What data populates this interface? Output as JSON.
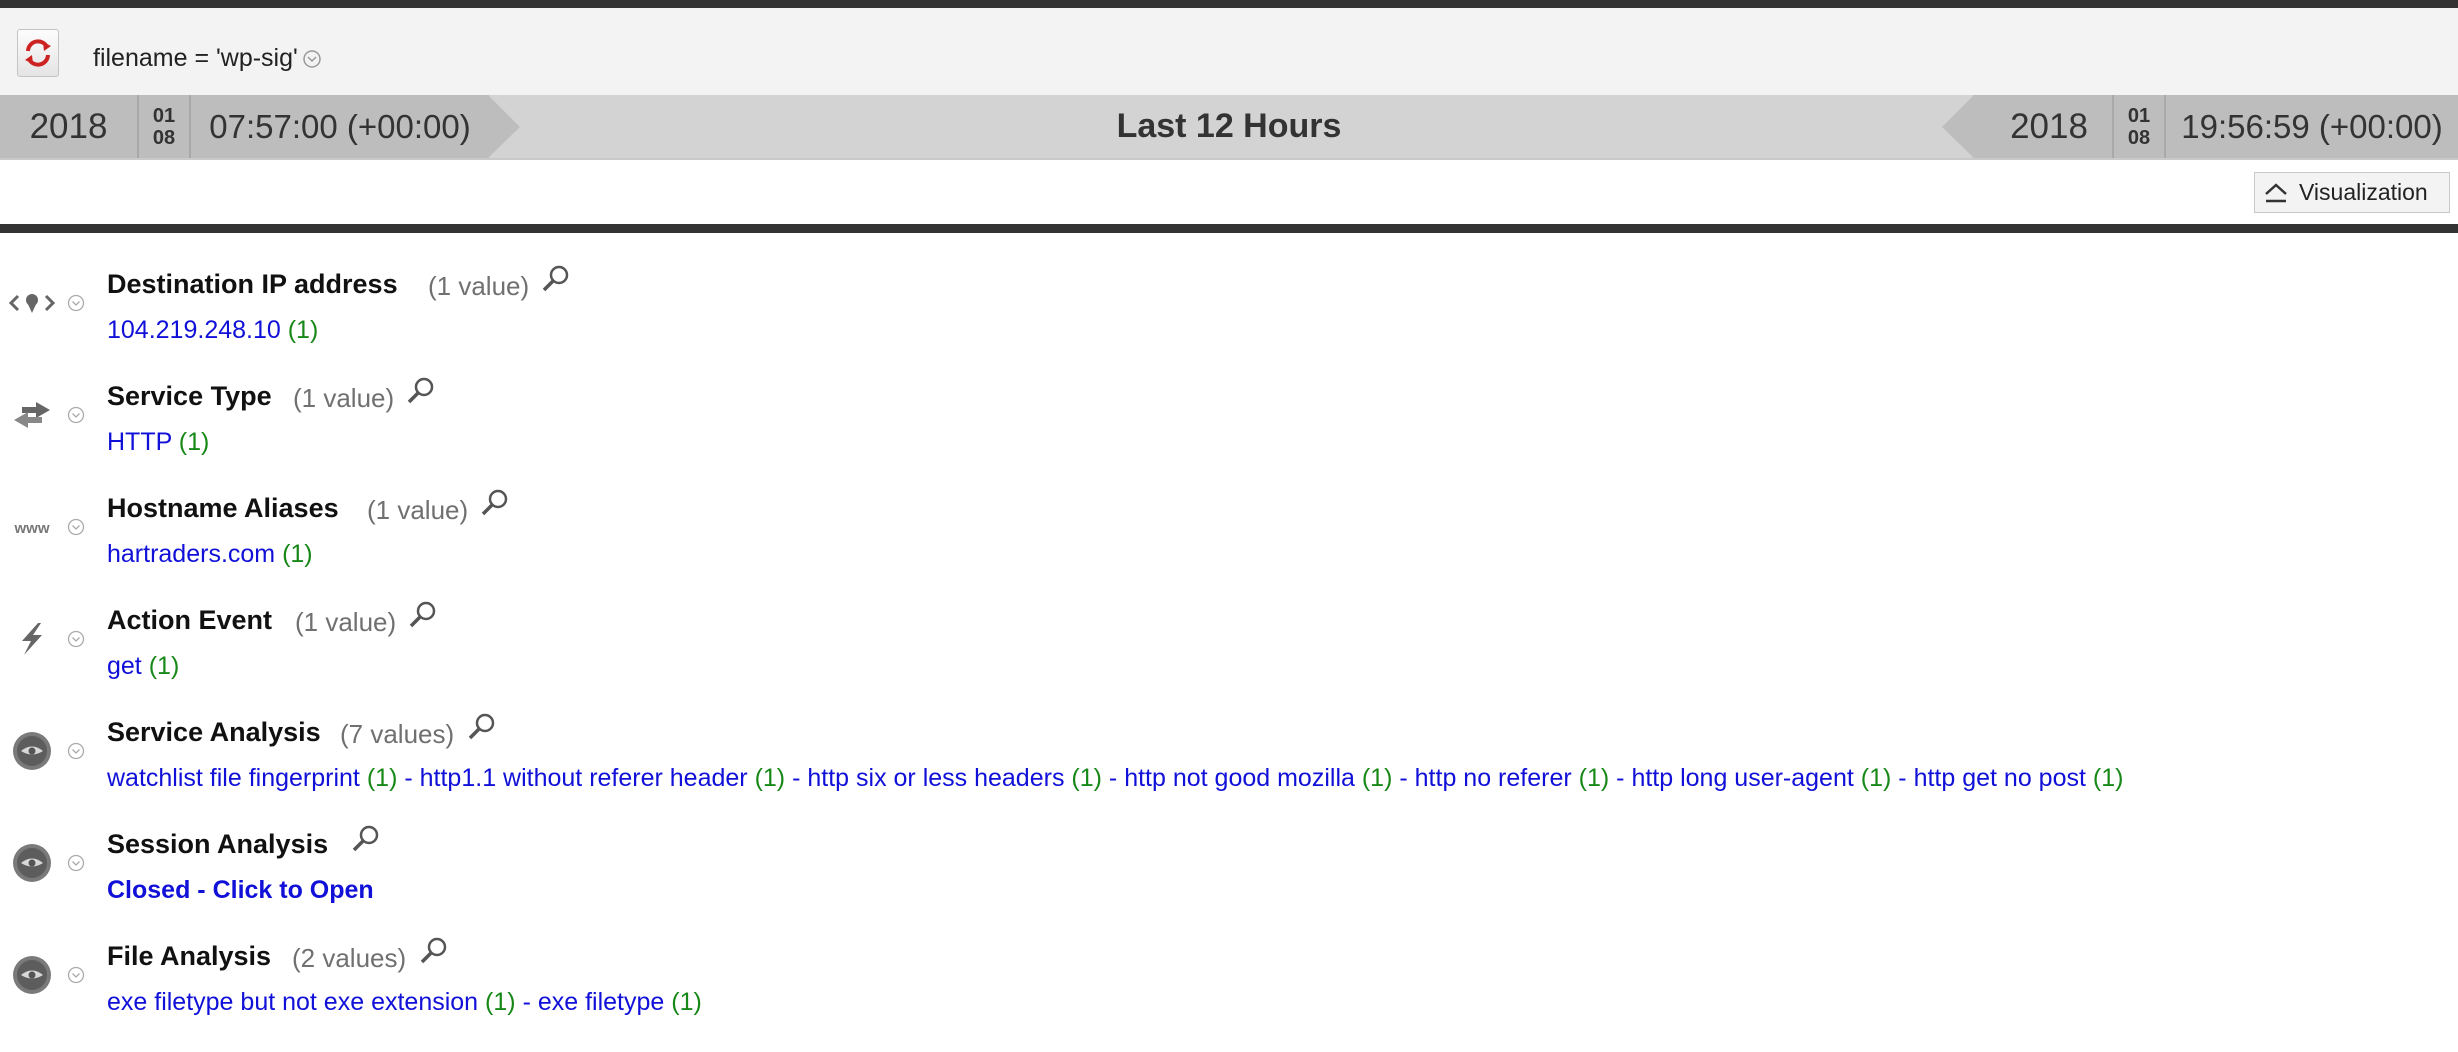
{
  "query": {
    "text": "filename = 'wp-sig'"
  },
  "time_range": {
    "start": {
      "year": "2018",
      "month": "01",
      "day": "08",
      "time": "07:57:00 (+00:00)"
    },
    "label": "Last 12 Hours",
    "end": {
      "year": "2018",
      "month": "01",
      "day": "08",
      "time": "19:56:59 (+00:00)"
    }
  },
  "visualization_button": {
    "label": "Visualization"
  },
  "meta": [
    {
      "title": "Destination IP address",
      "count": "(1 value)",
      "icon": "location-icon",
      "values": [
        {
          "text": "104.219.248.10",
          "count": "(1)"
        }
      ]
    },
    {
      "title": "Service Type",
      "count": "(1 value)",
      "icon": "exchange-arrows-icon",
      "values": [
        {
          "text": "HTTP",
          "count": "(1)"
        }
      ]
    },
    {
      "title": "Hostname Aliases",
      "count": "(1 value)",
      "icon": "www-icon",
      "values": [
        {
          "text": "hartraders.com",
          "count": "(1)"
        }
      ]
    },
    {
      "title": "Action Event",
      "count": "(1 value)",
      "icon": "lightning-icon",
      "values": [
        {
          "text": "get",
          "count": "(1)"
        }
      ]
    },
    {
      "title": "Service Analysis",
      "count": "(7 values)",
      "icon": "analysis-icon",
      "values": [
        {
          "text": "watchlist file fingerprint",
          "count": "(1)"
        },
        {
          "text": "http1.1 without referer header",
          "count": "(1)"
        },
        {
          "text": "http six or less headers",
          "count": "(1)"
        },
        {
          "text": "http not good mozilla",
          "count": "(1)"
        },
        {
          "text": "http no referer",
          "count": "(1)"
        },
        {
          "text": "http long user-agent",
          "count": "(1)"
        },
        {
          "text": "http get no post",
          "count": "(1)"
        }
      ]
    },
    {
      "title": "Session Analysis",
      "count": "",
      "icon": "analysis-icon",
      "closed_text": "Closed - Click to Open"
    },
    {
      "title": "File Analysis",
      "count": "(2 values)",
      "icon": "analysis-icon",
      "values": [
        {
          "text": "exe filetype but not exe extension",
          "count": "(1)"
        },
        {
          "text": "exe filetype",
          "count": "(1)"
        }
      ]
    }
  ],
  "separator": "-",
  "colors": {
    "link": "#1010d8",
    "count": "#178817",
    "bar": "#333333"
  }
}
